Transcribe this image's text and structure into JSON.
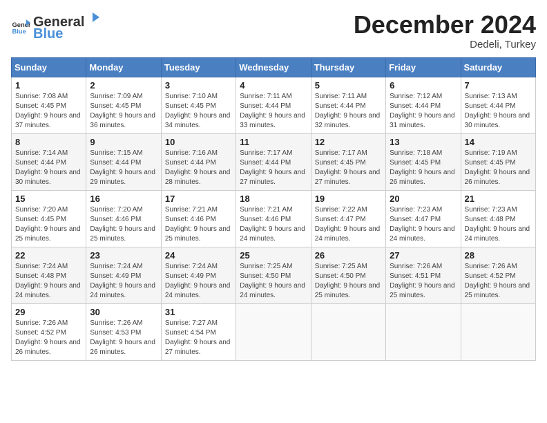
{
  "header": {
    "logo_general": "General",
    "logo_blue": "Blue",
    "month_title": "December 2024",
    "location": "Dedeli, Turkey"
  },
  "weekdays": [
    "Sunday",
    "Monday",
    "Tuesday",
    "Wednesday",
    "Thursday",
    "Friday",
    "Saturday"
  ],
  "weeks": [
    [
      {
        "day": "1",
        "sunrise": "7:08 AM",
        "sunset": "4:45 PM",
        "daylight": "9 hours and 37 minutes."
      },
      {
        "day": "2",
        "sunrise": "7:09 AM",
        "sunset": "4:45 PM",
        "daylight": "9 hours and 36 minutes."
      },
      {
        "day": "3",
        "sunrise": "7:10 AM",
        "sunset": "4:45 PM",
        "daylight": "9 hours and 34 minutes."
      },
      {
        "day": "4",
        "sunrise": "7:11 AM",
        "sunset": "4:44 PM",
        "daylight": "9 hours and 33 minutes."
      },
      {
        "day": "5",
        "sunrise": "7:11 AM",
        "sunset": "4:44 PM",
        "daylight": "9 hours and 32 minutes."
      },
      {
        "day": "6",
        "sunrise": "7:12 AM",
        "sunset": "4:44 PM",
        "daylight": "9 hours and 31 minutes."
      },
      {
        "day": "7",
        "sunrise": "7:13 AM",
        "sunset": "4:44 PM",
        "daylight": "9 hours and 30 minutes."
      }
    ],
    [
      {
        "day": "8",
        "sunrise": "7:14 AM",
        "sunset": "4:44 PM",
        "daylight": "9 hours and 30 minutes."
      },
      {
        "day": "9",
        "sunrise": "7:15 AM",
        "sunset": "4:44 PM",
        "daylight": "9 hours and 29 minutes."
      },
      {
        "day": "10",
        "sunrise": "7:16 AM",
        "sunset": "4:44 PM",
        "daylight": "9 hours and 28 minutes."
      },
      {
        "day": "11",
        "sunrise": "7:17 AM",
        "sunset": "4:44 PM",
        "daylight": "9 hours and 27 minutes."
      },
      {
        "day": "12",
        "sunrise": "7:17 AM",
        "sunset": "4:45 PM",
        "daylight": "9 hours and 27 minutes."
      },
      {
        "day": "13",
        "sunrise": "7:18 AM",
        "sunset": "4:45 PM",
        "daylight": "9 hours and 26 minutes."
      },
      {
        "day": "14",
        "sunrise": "7:19 AM",
        "sunset": "4:45 PM",
        "daylight": "9 hours and 26 minutes."
      }
    ],
    [
      {
        "day": "15",
        "sunrise": "7:20 AM",
        "sunset": "4:45 PM",
        "daylight": "9 hours and 25 minutes."
      },
      {
        "day": "16",
        "sunrise": "7:20 AM",
        "sunset": "4:46 PM",
        "daylight": "9 hours and 25 minutes."
      },
      {
        "day": "17",
        "sunrise": "7:21 AM",
        "sunset": "4:46 PM",
        "daylight": "9 hours and 25 minutes."
      },
      {
        "day": "18",
        "sunrise": "7:21 AM",
        "sunset": "4:46 PM",
        "daylight": "9 hours and 24 minutes."
      },
      {
        "day": "19",
        "sunrise": "7:22 AM",
        "sunset": "4:47 PM",
        "daylight": "9 hours and 24 minutes."
      },
      {
        "day": "20",
        "sunrise": "7:23 AM",
        "sunset": "4:47 PM",
        "daylight": "9 hours and 24 minutes."
      },
      {
        "day": "21",
        "sunrise": "7:23 AM",
        "sunset": "4:48 PM",
        "daylight": "9 hours and 24 minutes."
      }
    ],
    [
      {
        "day": "22",
        "sunrise": "7:24 AM",
        "sunset": "4:48 PM",
        "daylight": "9 hours and 24 minutes."
      },
      {
        "day": "23",
        "sunrise": "7:24 AM",
        "sunset": "4:49 PM",
        "daylight": "9 hours and 24 minutes."
      },
      {
        "day": "24",
        "sunrise": "7:24 AM",
        "sunset": "4:49 PM",
        "daylight": "9 hours and 24 minutes."
      },
      {
        "day": "25",
        "sunrise": "7:25 AM",
        "sunset": "4:50 PM",
        "daylight": "9 hours and 24 minutes."
      },
      {
        "day": "26",
        "sunrise": "7:25 AM",
        "sunset": "4:50 PM",
        "daylight": "9 hours and 25 minutes."
      },
      {
        "day": "27",
        "sunrise": "7:26 AM",
        "sunset": "4:51 PM",
        "daylight": "9 hours and 25 minutes."
      },
      {
        "day": "28",
        "sunrise": "7:26 AM",
        "sunset": "4:52 PM",
        "daylight": "9 hours and 25 minutes."
      }
    ],
    [
      {
        "day": "29",
        "sunrise": "7:26 AM",
        "sunset": "4:52 PM",
        "daylight": "9 hours and 26 minutes."
      },
      {
        "day": "30",
        "sunrise": "7:26 AM",
        "sunset": "4:53 PM",
        "daylight": "9 hours and 26 minutes."
      },
      {
        "day": "31",
        "sunrise": "7:27 AM",
        "sunset": "4:54 PM",
        "daylight": "9 hours and 27 minutes."
      },
      null,
      null,
      null,
      null
    ]
  ],
  "labels": {
    "sunrise": "Sunrise:",
    "sunset": "Sunset:",
    "daylight": "Daylight:"
  }
}
